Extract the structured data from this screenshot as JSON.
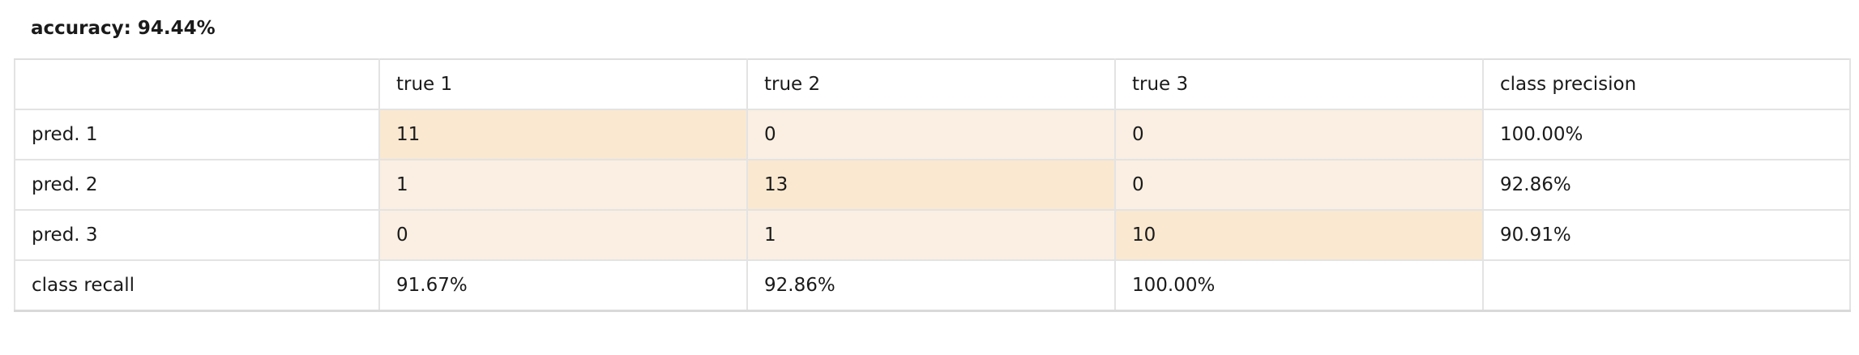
{
  "accuracy_label": "accuracy: 94.44%",
  "header": {
    "corner": "",
    "cols": [
      "true 1",
      "true 2",
      "true 3"
    ],
    "precision_label": "class precision"
  },
  "rows": [
    {
      "label": "pred. 1",
      "cells": [
        "11",
        "0",
        "0"
      ],
      "precision": "100.00%"
    },
    {
      "label": "pred. 2",
      "cells": [
        "1",
        "13",
        "0"
      ],
      "precision": "92.86%"
    },
    {
      "label": "pred. 3",
      "cells": [
        "0",
        "1",
        "10"
      ],
      "precision": "90.91%"
    }
  ],
  "recall": {
    "label": "class recall",
    "values": [
      "91.67%",
      "92.86%",
      "100.00%"
    ],
    "corner": ""
  },
  "colors": {
    "diagonal_cell": "#fae8d0",
    "offdiagonal_cell": "#faefe2",
    "border": "#e3e3e3"
  }
}
